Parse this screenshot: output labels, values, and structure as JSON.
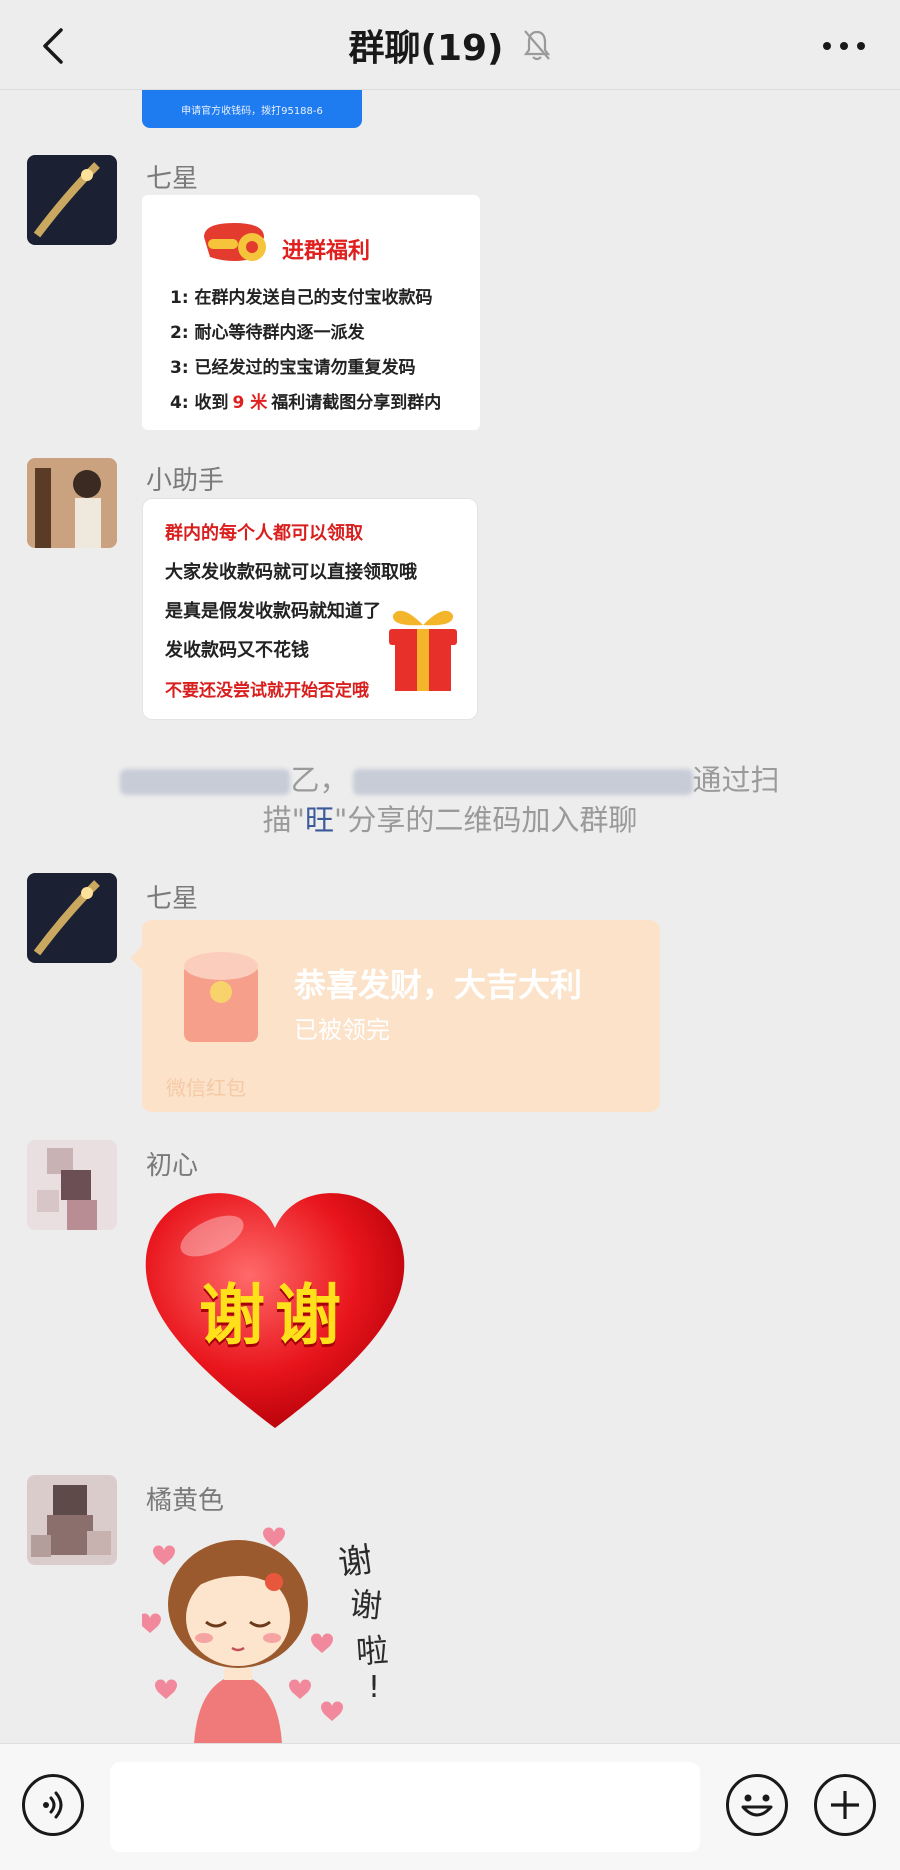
{
  "header": {
    "title": "群聊(19)",
    "back_icon": "chevron-left-icon",
    "mute_icon": "bell-off-icon",
    "more_icon": "more-horizontal-icon"
  },
  "top_banner": {
    "text": "申请官方收钱码，拨打95188-6"
  },
  "messages": [
    {
      "sender": "七星",
      "welfare": {
        "title": "进群福利",
        "lines": [
          "1:  在群内发送自己的支付宝收款码",
          "2:  耐心等待群内逐一派发",
          "3:  已经发过的宝宝请勿重复发码"
        ],
        "line4_prefix": "4:  收到",
        "line4_highlight": "9 米",
        "line4_suffix": "福利请截图分享到群内"
      }
    },
    {
      "sender": "小助手",
      "notice": {
        "line1": "群内的每个人都可以领取",
        "line2": "大家发收款码就可以直接领取哦",
        "line3": "是真是假发收款码就知道了",
        "line4": "发收款码又不花钱",
        "line5": "不要还没尝试就开始否定哦"
      }
    },
    {
      "system": {
        "part1": "乙，",
        "part2": "通过扫",
        "part3": "描\"",
        "highlight": "旺",
        "part4": "\"分享的二维码加入群聊"
      }
    },
    {
      "sender": "七星",
      "red_packet": {
        "title": "恭喜发财，大吉大利",
        "status": "已被领完",
        "footer": "微信红包"
      }
    },
    {
      "sender": "初心",
      "sticker": {
        "text": "谢谢"
      }
    },
    {
      "sender": "橘黄色",
      "sticker": {
        "text_line1": "谢",
        "text_line2": "谢",
        "text_line3": "啦",
        "text_line4": "!"
      }
    }
  ],
  "composer": {
    "voice_icon": "voice-icon",
    "emoji_icon": "emoji-icon",
    "plus_icon": "plus-icon",
    "input_value": ""
  },
  "colors": {
    "background": "#ededed",
    "accent_red": "#e0201f",
    "red_packet": "#fbe2c9"
  }
}
